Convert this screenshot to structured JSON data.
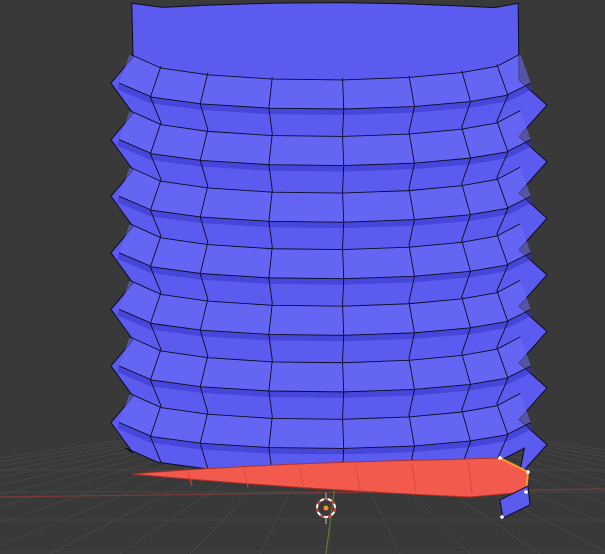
{
  "viewport": {
    "background_color": "#393939",
    "grid_color": "#454545",
    "axis_x_color": "#7a3b3b",
    "axis_y_color": "#5e7a2e"
  },
  "mesh": {
    "object": "threaded-screw",
    "face_color": "#5b5bf0",
    "face_shadow_color": "#3232c4",
    "face_highlight_color": "#6d6df7",
    "wire_color": "#0c0c22",
    "thread_count": 7,
    "selected_face_color": "#f25a4e",
    "selected_face_shade": "#e0463c",
    "selected_edge_color": "#ff9a2c",
    "selected_vertex_color": "#ffffff"
  },
  "cursor_3d": {
    "icon": "3d-cursor-icon",
    "ring_color": "#ffffff",
    "dash_color": "#d23a2e",
    "center_color": "#ff8c20"
  }
}
